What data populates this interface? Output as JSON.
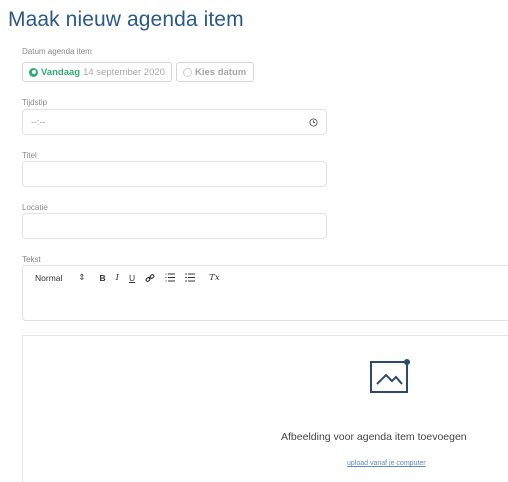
{
  "page": {
    "title": "Maak nieuw agenda item"
  },
  "date_field": {
    "label": "Datum agenda item",
    "today_label": "Vandaag",
    "today_date": "14 september 2020",
    "pick_label": "Kies datum"
  },
  "time_field": {
    "label": "Tijdstip",
    "value": "--:--",
    "icon": "clock-icon"
  },
  "title_field": {
    "label": "Titel",
    "value": ""
  },
  "location_field": {
    "label": "Locatie",
    "value": ""
  },
  "text_field": {
    "label": "Tekst",
    "toolbar": {
      "format_select": "Normal",
      "format_arrows": "⇕",
      "bold": "B",
      "italic": "I",
      "underline": "U",
      "clear": "Tx"
    }
  },
  "image_upload": {
    "title": "Afbeelding voor agenda item toevoegen",
    "link": "upload vanaf je computer",
    "icon": "image-icon"
  },
  "colors": {
    "title": "#2a5a8a",
    "accent_green": "#2fae74",
    "link": "#5a8cc5",
    "icon_blue": "#2c4a6e"
  }
}
